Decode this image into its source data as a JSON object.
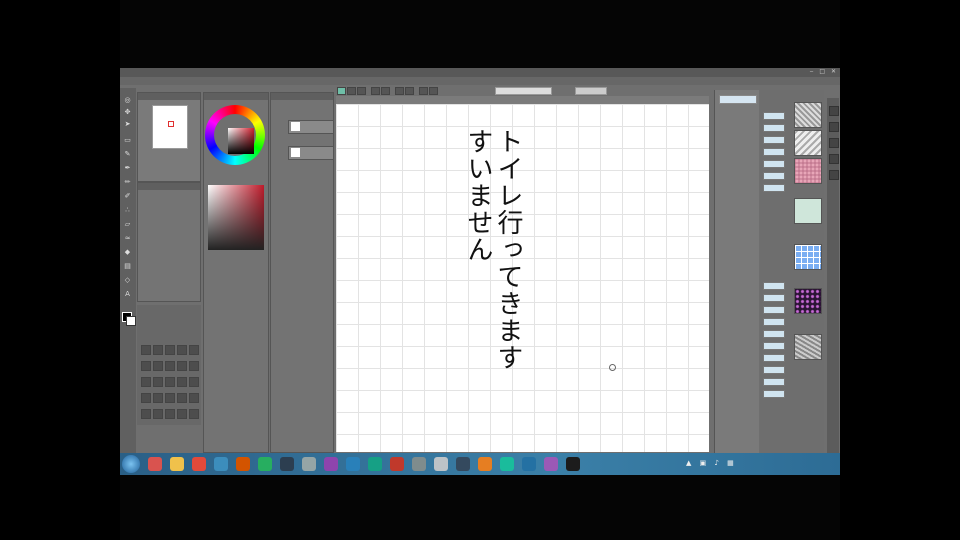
{
  "window": {
    "title": "",
    "controls": "‒ □ ✕"
  },
  "menubar": {
    "items": [
      "",
      "",
      "",
      "",
      "",
      "",
      "",
      ""
    ]
  },
  "canvas": {
    "text_columns": [
      "トイレ行ってきます",
      "すいません"
    ]
  },
  "panels": {
    "navigator_tab": "",
    "layer_items": [
      "",
      ""
    ],
    "material_tab": ""
  },
  "taskbar": {
    "time": "",
    "date": ""
  },
  "colors": {
    "app_bg": "#6f6f6f",
    "canvas_bg": "#ffffff",
    "accent_red": "#d21f2f",
    "taskbar": "#3b80a8"
  },
  "icons": [
    "start-icon",
    "browser-icon",
    "folder-icon",
    "chrome-icon",
    "paint-icon",
    "clip-studio-icon"
  ]
}
